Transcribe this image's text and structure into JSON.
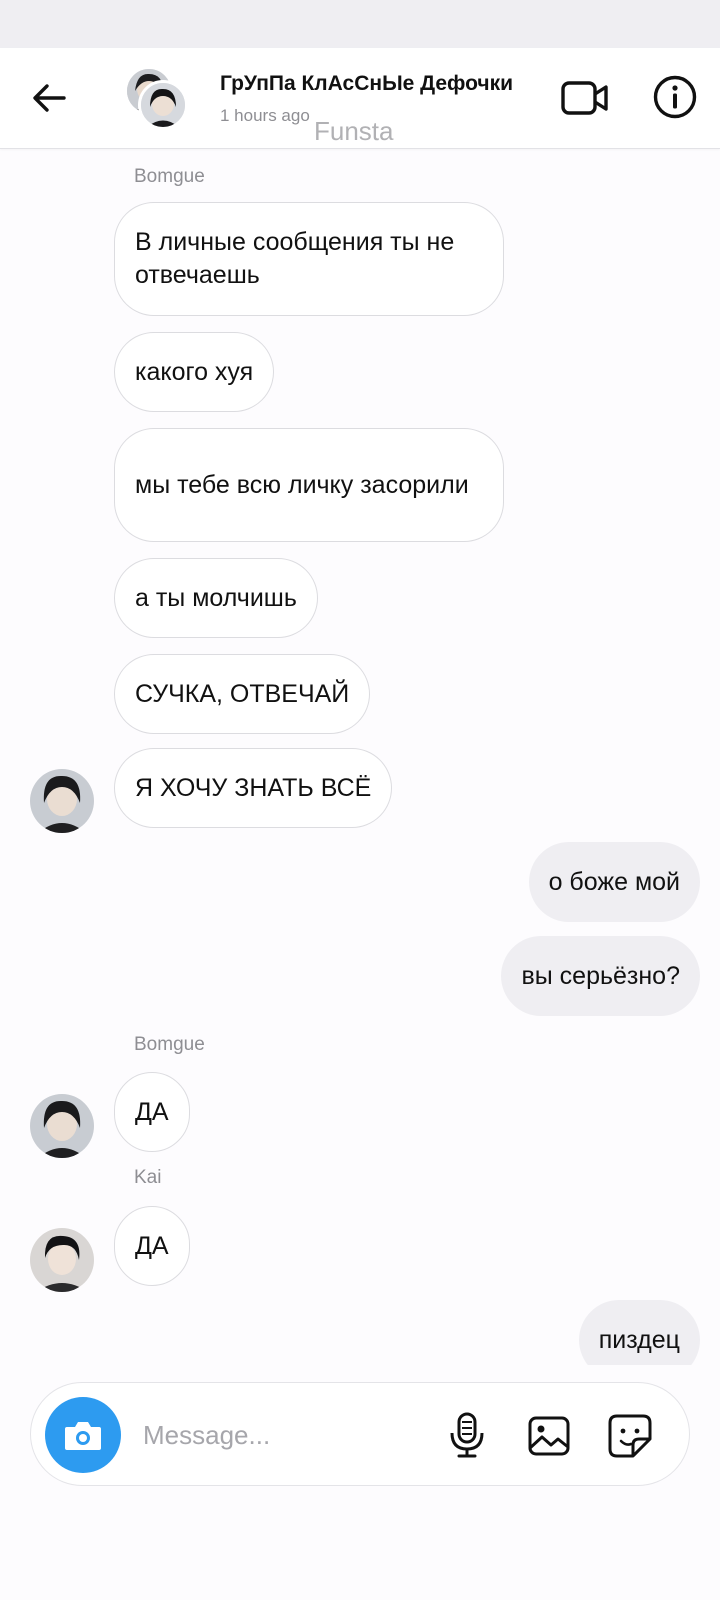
{
  "header": {
    "title": "ГрУпПа КлАсСнЫе Дефочки",
    "subtitle": "1 hours ago",
    "watermark": "Funsta"
  },
  "messages": [
    {
      "sender": "Bomgue"
    },
    {
      "text": "В личные сообщения ты не отвечаешь",
      "direction": "in"
    },
    {
      "text": "какого хуя",
      "direction": "in"
    },
    {
      "text": "мы тебе всю личку засорили",
      "direction": "in"
    },
    {
      "text": "а ты молчишь",
      "direction": "in"
    },
    {
      "text": "СУЧКА, ОТВЕЧАЙ",
      "direction": "in"
    },
    {
      "text": "Я ХОЧУ ЗНАТЬ ВСЁ",
      "direction": "in"
    },
    {
      "text": "о боже мой",
      "direction": "out"
    },
    {
      "text": "вы серьёзно?",
      "direction": "out"
    },
    {
      "sender": "Bomgue"
    },
    {
      "text": "ДА",
      "direction": "in"
    },
    {
      "sender": "Kai"
    },
    {
      "text": "ДА",
      "direction": "in"
    },
    {
      "text": "пиздец",
      "direction": "out"
    }
  ],
  "composer": {
    "placeholder": "Message..."
  },
  "colors": {
    "camera_button": "#2d9bf0",
    "outgoing_bubble": "#efeef2",
    "meta_text": "#8e8e93"
  },
  "icons": {
    "back": "arrow-left-icon",
    "video": "video-camera-icon",
    "info": "info-icon",
    "camera": "camera-icon",
    "mic": "microphone-icon",
    "gallery": "image-icon",
    "sticker": "sticker-icon"
  }
}
